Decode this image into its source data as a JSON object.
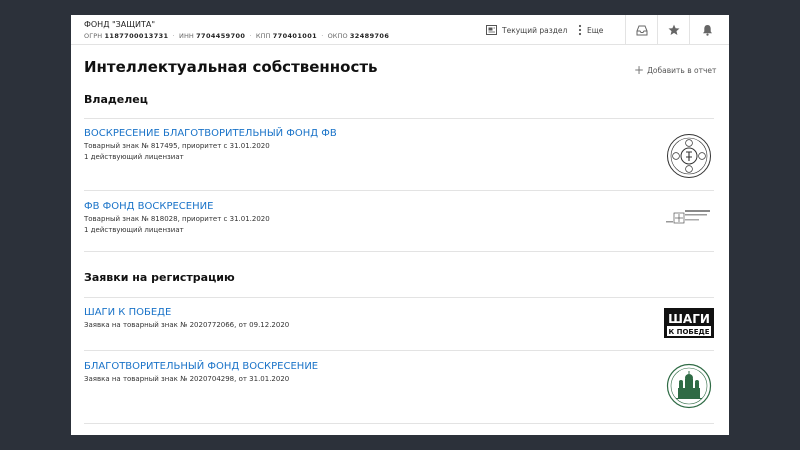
{
  "header": {
    "org_name": "ФОНД \"ЗАЩИТА\"",
    "codes": [
      {
        "label": "ОГРН",
        "value": "1187700013731"
      },
      {
        "label": "ИНН",
        "value": "7704459700"
      },
      {
        "label": "КПП",
        "value": "770401001"
      },
      {
        "label": "ОКПО",
        "value": "32489706"
      }
    ],
    "current_section_label": "Текущий раздел",
    "more_label": "Еще"
  },
  "page": {
    "title": "Интеллектуальная собственность",
    "add_to_report_label": "Добавить в отчет"
  },
  "owner": {
    "title": "Владелец",
    "items": [
      {
        "name": "ВОСКРЕСЕНИЕ БЛАГОТВОРИТЕЛЬНЫЙ ФОНД ФВ",
        "detail": "Товарный знак № 817495, приоритет с 31.01.2020",
        "licensees": "1 действующий лицензиат",
        "logo": "circular-seal-logo"
      },
      {
        "name": "ФВ ФОНД ВОСКРЕСЕНИЕ",
        "detail": "Товарный знак № 818028, приоритет с 31.01.2020",
        "licensees": "1 действующий лицензиат",
        "logo": "text-wordmark-logo"
      }
    ]
  },
  "applications": {
    "title": "Заявки на регистрацию",
    "items": [
      {
        "name": "ШАГИ К ПОБЕДЕ",
        "detail": "Заявка на товарный знак № 2020772066, от 09.12.2020",
        "logo": "black-box-logo",
        "logo_text_1": "ШАГИ",
        "logo_text_2": "К ПОБЕДЕ"
      },
      {
        "name": "БЛАГОТВОРИТЕЛЬНЫЙ ФОНД ВОСКРЕСЕНИЕ",
        "detail": "Заявка на товарный знак № 2020704298, от 31.01.2020",
        "logo": "cathedral-seal-logo"
      }
    ]
  },
  "colors": {
    "link": "#1a73c8",
    "background": "#2c313a",
    "panel": "#ffffff",
    "seal_green": "#2f6b45"
  }
}
